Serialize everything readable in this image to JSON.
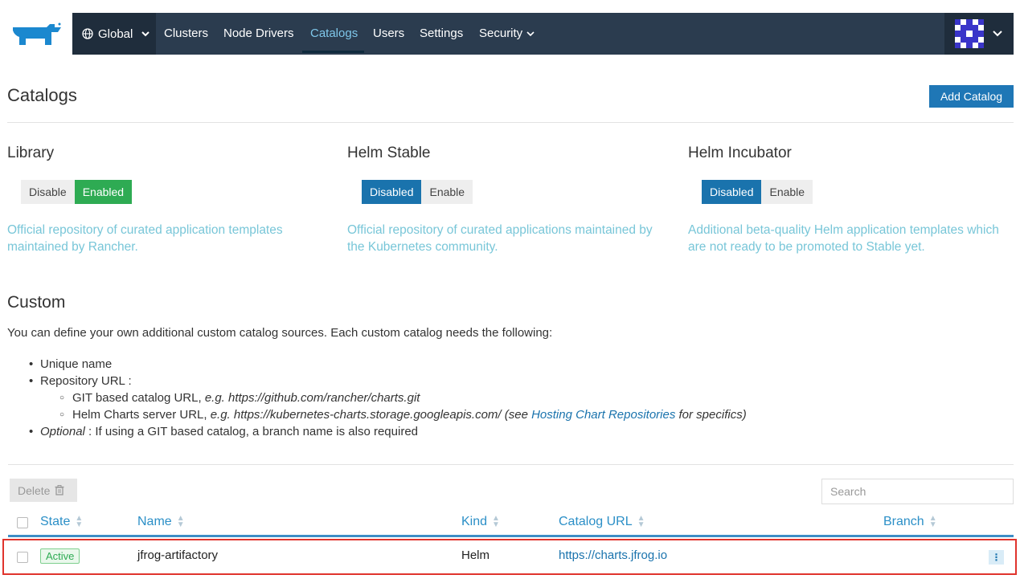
{
  "header": {
    "global_label": "Global",
    "nav": [
      {
        "label": "Clusters"
      },
      {
        "label": "Node Drivers"
      },
      {
        "label": "Catalogs"
      },
      {
        "label": "Users"
      },
      {
        "label": "Settings"
      },
      {
        "label": "Security"
      }
    ],
    "active_nav": "Catalogs"
  },
  "page": {
    "title": "Catalogs",
    "add_button": "Add Catalog"
  },
  "catalogs": [
    {
      "name": "Library",
      "left_option": "Disable",
      "right_option": "Enabled",
      "selected": "Enabled",
      "description": "Official repository of curated application templates maintained by Rancher."
    },
    {
      "name": "Helm Stable",
      "left_option": "Disabled",
      "right_option": "Enable",
      "selected": "Disabled",
      "description": "Official repository of curated applications maintained by the Kubernetes community."
    },
    {
      "name": "Helm Incubator",
      "left_option": "Disabled",
      "right_option": "Enable",
      "selected": "Disabled",
      "description": "Additional beta-quality Helm application templates which are not ready to be promoted to Stable yet."
    }
  ],
  "custom": {
    "title": "Custom",
    "intro": "You can define your own additional custom catalog sources. Each custom catalog needs the following:",
    "item_unique": "Unique name",
    "item_repo": "Repository URL :",
    "git_prefix": "GIT based catalog URL, ",
    "git_example": "e.g. https://github.com/rancher/charts.git",
    "helm_prefix": "Helm Charts server URL, ",
    "helm_example": "e.g. https://kubernetes-charts.storage.googleapis.com/ (see ",
    "helm_link": "Hosting Chart Repositories",
    "helm_suffix": " for specifics)",
    "optional_label": "Optional",
    "optional_text": " : If using a GIT based catalog, a branch name is also required"
  },
  "table": {
    "delete_label": "Delete",
    "search_placeholder": "Search",
    "columns": {
      "state": "State",
      "name": "Name",
      "kind": "Kind",
      "url": "Catalog URL",
      "branch": "Branch"
    },
    "rows": [
      {
        "state": "Active",
        "name": "jfrog-artifactory",
        "kind": "Helm",
        "url": "https://charts.jfrog.io",
        "branch": ""
      }
    ]
  },
  "colors": {
    "topbar": "#2b3c4f",
    "primary": "#1a73ad",
    "enabled": "#2eab53",
    "highlight": "#e0342d"
  }
}
